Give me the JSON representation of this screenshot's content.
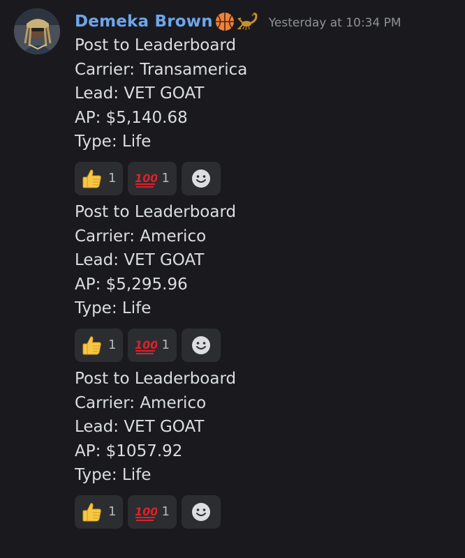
{
  "author": {
    "name": "Demeka Brown",
    "name_emojis": [
      "basketball-icon",
      "scorpion-icon"
    ],
    "timestamp": "Yesterday at 10:34 PM"
  },
  "messages": [
    {
      "lines": [
        "Post to Leaderboard",
        "Carrier: Transamerica",
        "Lead: VET GOAT",
        "AP: $5,140.68",
        "Type: Life"
      ],
      "reactions": [
        {
          "icon": "thumbs-up-icon",
          "count": "1"
        },
        {
          "icon": "hundred-points-icon",
          "count": "1"
        }
      ]
    },
    {
      "lines": [
        "Post to Leaderboard",
        "Carrier: Americo",
        "Lead: VET GOAT",
        "AP: $5,295.96",
        "Type: Life"
      ],
      "reactions": [
        {
          "icon": "thumbs-up-icon",
          "count": "1"
        },
        {
          "icon": "hundred-points-icon",
          "count": "1"
        }
      ]
    },
    {
      "lines": [
        "Post to Leaderboard",
        "Carrier: Americo",
        "Lead: VET GOAT",
        "AP: $1057.92",
        "Type: Life"
      ],
      "reactions": [
        {
          "icon": "thumbs-up-icon",
          "count": "1"
        },
        {
          "icon": "hundred-points-icon",
          "count": "1"
        }
      ]
    }
  ],
  "colors": {
    "background": "#1a1a1e",
    "username": "#6ea6ea",
    "text": "#dbdee1",
    "timestamp": "#8e9297",
    "reaction_bg": "#2b2d31"
  }
}
